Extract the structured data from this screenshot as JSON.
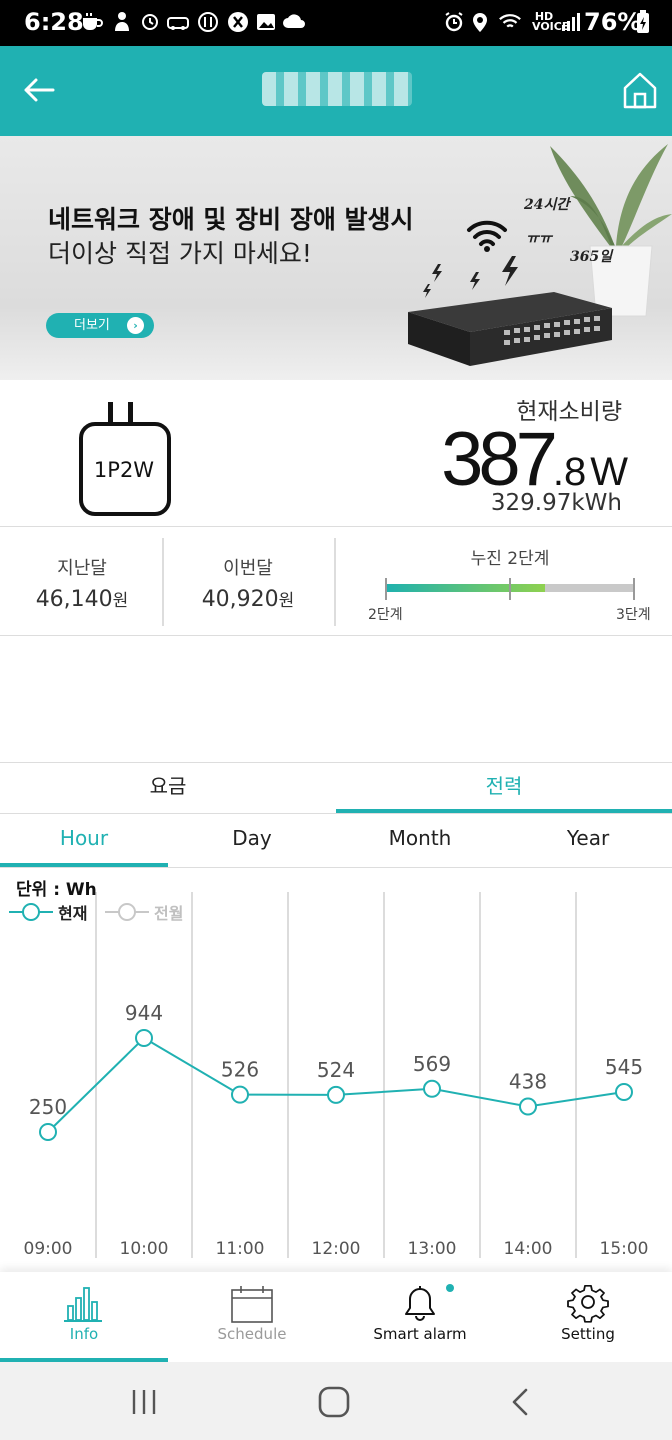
{
  "status_bar": {
    "time": "6:28",
    "battery": "76%",
    "network_label": "HD VOICE",
    "icons": [
      "cup-icon",
      "hand-icon",
      "watch-icon",
      "car-icon",
      "chat-icon",
      "x-icon",
      "image-icon",
      "cloud-icon",
      "alarm-icon",
      "location-icon",
      "wifi-icon",
      "signal-icon",
      "battery-icon"
    ]
  },
  "header": {
    "back_icon": "arrow-left-icon",
    "home_icon": "home-icon"
  },
  "banner": {
    "title": "네트워크 장애 및 장비 장애 발생시",
    "subtitle": "더이상 직접 가지 마세요!",
    "more_label": "더보기",
    "art_text_1": "24시간",
    "art_text_2": "ㅠㅠ",
    "art_text_3": "365일"
  },
  "device": {
    "plug_label": "1P2W",
    "consumption_label": "현재소비량",
    "power_integer": "387",
    "power_decimal": ".8",
    "power_unit": "W",
    "energy_total": "329.97kWh"
  },
  "cost": {
    "last_month_label": "지난달",
    "last_month_value": "46,140",
    "this_month_label": "이번달",
    "this_month_value": "40,920",
    "currency": "원",
    "tier_title": "누진 2단계",
    "tier_min": "2단계",
    "tier_max": "3단계",
    "tier_progress": 0.64
  },
  "tabs": {
    "main": [
      {
        "label": "요금",
        "active": false
      },
      {
        "label": "전력",
        "active": true
      }
    ],
    "period": [
      {
        "label": "Hour",
        "active": true
      },
      {
        "label": "Day",
        "active": false
      },
      {
        "label": "Month",
        "active": false
      },
      {
        "label": "Year",
        "active": false
      }
    ]
  },
  "chart_data": {
    "type": "line",
    "unit_label": "단위 : Wh",
    "categories": [
      "09:00",
      "10:00",
      "11:00",
      "12:00",
      "13:00",
      "14:00",
      "15:00"
    ],
    "series": [
      {
        "name": "현재",
        "values": [
          250,
          944,
          526,
          524,
          569,
          438,
          545
        ],
        "color": "#20b1b2"
      },
      {
        "name": "전월",
        "values": [],
        "color": "#c8c8c8"
      }
    ],
    "grid": true,
    "legend_position": "top-left"
  },
  "bottom_nav": [
    {
      "label": "Info",
      "icon": "bar-chart-icon",
      "active": true
    },
    {
      "label": "Schedule",
      "icon": "calendar-icon",
      "active": false
    },
    {
      "label": "Smart alarm",
      "icon": "bell-icon",
      "active": false
    },
    {
      "label": "Setting",
      "icon": "gear-icon",
      "active": false
    }
  ],
  "system_nav": [
    "recent-apps-icon",
    "home-circle-icon",
    "back-chevron-icon"
  ],
  "colors": {
    "accent": "#20b1b2",
    "inactive": "#c8c8c8"
  }
}
